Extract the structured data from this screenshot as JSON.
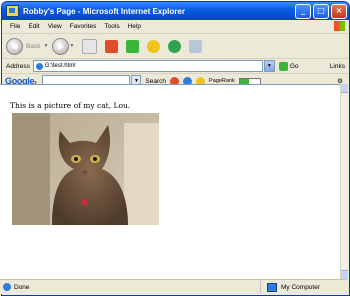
{
  "window": {
    "title": "Robby's Page - Microsoft Internet Explorer"
  },
  "menu": [
    "File",
    "Edit",
    "View",
    "Favorites",
    "Tools",
    "Help"
  ],
  "toolbar": {
    "back_label": "Back"
  },
  "address": {
    "label": "Address",
    "value": "G:\\test.html",
    "go_label": "Go",
    "links_label": "Links"
  },
  "google": {
    "logo": "Google",
    "search_label": "Search",
    "pagerank_label": "PageRank"
  },
  "page": {
    "text": "This is a picture of my cat, Lou."
  },
  "status": {
    "text": "Done",
    "zone": "My Computer"
  },
  "colors": {
    "titlebar": "#0a5ee0",
    "chrome": "#ece9d8",
    "border": "#7f9db9"
  }
}
